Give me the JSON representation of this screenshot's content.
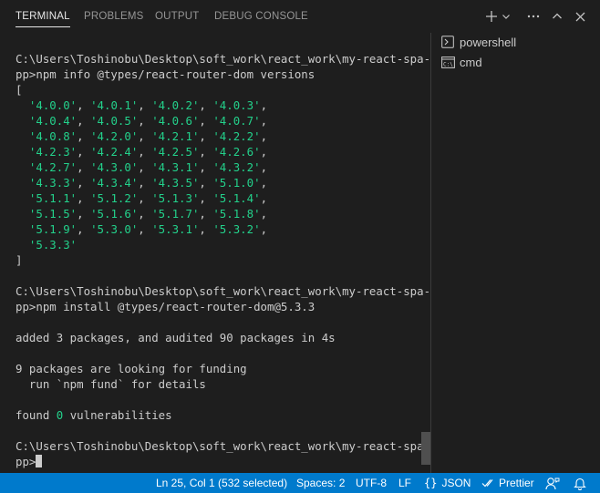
{
  "tabs": [
    {
      "label": "TERMINAL",
      "active": true
    },
    {
      "label": "PROBLEMS",
      "active": false
    },
    {
      "label": "OUTPUT",
      "active": false
    },
    {
      "label": "DEBUG CONSOLE",
      "active": false
    }
  ],
  "header_actions": [
    "plus-icon",
    "chevron-down-icon",
    "ellipsis-icon",
    "chevron-up-icon",
    "close-icon"
  ],
  "terminal": {
    "prompt_path_1": "C:\\Users\\Toshinobu\\Desktop\\soft_work\\react_work\\my-react-spa-a",
    "prompt_cmd_1": "pp>npm info @types/react-router-dom versions",
    "bracket_open": "[",
    "versions": [
      [
        "'4.0.0'",
        "'4.0.1'",
        "'4.0.2'",
        "'4.0.3'"
      ],
      [
        "'4.0.4'",
        "'4.0.5'",
        "'4.0.6'",
        "'4.0.7'"
      ],
      [
        "'4.0.8'",
        "'4.2.0'",
        "'4.2.1'",
        "'4.2.2'"
      ],
      [
        "'4.2.3'",
        "'4.2.4'",
        "'4.2.5'",
        "'4.2.6'"
      ],
      [
        "'4.2.7'",
        "'4.3.0'",
        "'4.3.1'",
        "'4.3.2'"
      ],
      [
        "'4.3.3'",
        "'4.3.4'",
        "'4.3.5'",
        "'5.1.0'"
      ],
      [
        "'5.1.1'",
        "'5.1.2'",
        "'5.1.3'",
        "'5.1.4'"
      ],
      [
        "'5.1.5'",
        "'5.1.6'",
        "'5.1.7'",
        "'5.1.8'"
      ],
      [
        "'5.1.9'",
        "'5.3.0'",
        "'5.3.1'",
        "'5.3.2'"
      ],
      [
        "'5.3.3'"
      ]
    ],
    "bracket_close": "]",
    "prompt_path_2": "C:\\Users\\Toshinobu\\Desktop\\soft_work\\react_work\\my-react-spa-a",
    "prompt_cmd_2": "pp>npm install @types/react-router-dom@5.3.3",
    "added_line": "added 3 packages, and audited 90 packages in 4s",
    "funding_line_1": "9 packages are looking for funding",
    "funding_line_2": "  run `npm fund` for details",
    "vuln_prefix": "found ",
    "vuln_count": "0",
    "vuln_suffix": " vulnerabilities",
    "prompt_path_3": "C:\\Users\\Toshinobu\\Desktop\\soft_work\\react_work\\my-react-spa-a",
    "prompt_cmd_3": "pp>"
  },
  "shells": [
    {
      "label": "powershell",
      "icon": "terminal-icon"
    },
    {
      "label": "cmd",
      "icon": "cmd-icon"
    }
  ],
  "statusbar": {
    "position": "Ln 25, Col 1 (532 selected)",
    "spaces": "Spaces: 2",
    "encoding": "UTF-8",
    "eol": "LF",
    "language": "JSON",
    "prettier": "Prettier"
  },
  "colors": {
    "background": "#1e1e1e",
    "statusbar": "#007acc",
    "string_green": "#23d18b"
  }
}
